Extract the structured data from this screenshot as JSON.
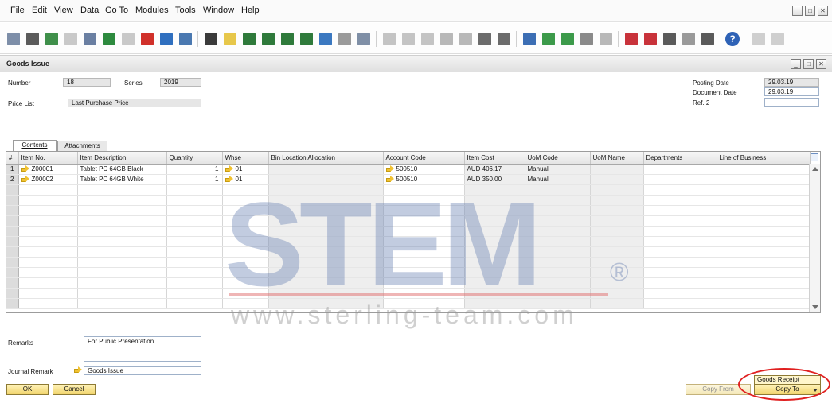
{
  "menu": {
    "items": [
      "File",
      "Edit",
      "View",
      "Data",
      "Go To",
      "Modules",
      "Tools",
      "Window",
      "Help"
    ]
  },
  "toolbar": {
    "icons": [
      "preview-icon",
      "print-icon",
      "email-icon",
      "sms-icon",
      "fax-icon",
      "export-excel-icon",
      "export-word-icon",
      "export-pdf-icon",
      "launch-app-icon",
      "lock-screen-icon",
      "find-icon",
      "add-icon",
      "first-record-icon",
      "previous-record-icon",
      "next-record-icon",
      "last-record-icon",
      "refresh-icon",
      "filter-icon",
      "sort-icon",
      "base-document-icon",
      "target-document-icon",
      "journal-icon",
      "transaction-journal-icon",
      "layout-designer-icon",
      "document-editing-icon",
      "references-icon",
      "form-settings-icon",
      "user-defined-values-icon",
      "query-icon",
      "messages-icon",
      "alerts-icon",
      "calendar-icon",
      "contacts-icon",
      "activity-icon",
      "organization-icon",
      "user-icon",
      "help-icon",
      "settings-icon",
      "customize-icon"
    ]
  },
  "window": {
    "title": "Goods Issue"
  },
  "header": {
    "number_label": "Number",
    "number_value": "18",
    "series_label": "Series",
    "series_value": "2019",
    "price_list_label": "Price List",
    "price_list_value": "Last Purchase Price",
    "posting_date_label": "Posting Date",
    "posting_date_value": "29.03.19",
    "document_date_label": "Document Date",
    "document_date_value": "29.03.19",
    "ref2_label": "Ref. 2",
    "ref2_value": ""
  },
  "tabs": [
    "Contents",
    "Attachments"
  ],
  "grid": {
    "columns": [
      "#",
      "Item No.",
      "Item Description",
      "Quantity",
      "Whse",
      "Bin Location Allocation",
      "Account Code",
      "Item Cost",
      "UoM Code",
      "UoM Name",
      "Departments",
      "Line of Business"
    ],
    "rows": [
      {
        "n": "1",
        "item_no": "Z00001",
        "desc": "Tablet PC 64GB Black",
        "qty": "1",
        "whse": "01",
        "bin": "",
        "account": "500510",
        "cost": "AUD 406.17",
        "uom_code": "Manual",
        "uom_name": "",
        "dept": "",
        "lob": ""
      },
      {
        "n": "2",
        "item_no": "Z00002",
        "desc": "Tablet PC 64GB White",
        "qty": "1",
        "whse": "01",
        "bin": "",
        "account": "500510",
        "cost": "AUD 350.00",
        "uom_code": "Manual",
        "uom_name": "",
        "dept": "",
        "lob": ""
      }
    ],
    "empty_row_count": 12
  },
  "footer": {
    "remarks_label": "Remarks",
    "remarks_value": "For Public Presentation",
    "journal_remark_label": "Journal Remark",
    "journal_remark_value": "Goods Issue",
    "ok_label": "OK",
    "cancel_label": "Cancel",
    "copy_from_label": "Copy From",
    "copy_to_label": "Copy To",
    "copy_to_popup_item": "Goods Receipt"
  },
  "watermark": {
    "logo_text": "STEM",
    "registered": "®",
    "url": "www.sterling-team.com"
  },
  "colors": {
    "button_yellow": "#f1d56e",
    "readonly_gray": "#e6e6e6",
    "highlight_red": "#e02020"
  }
}
